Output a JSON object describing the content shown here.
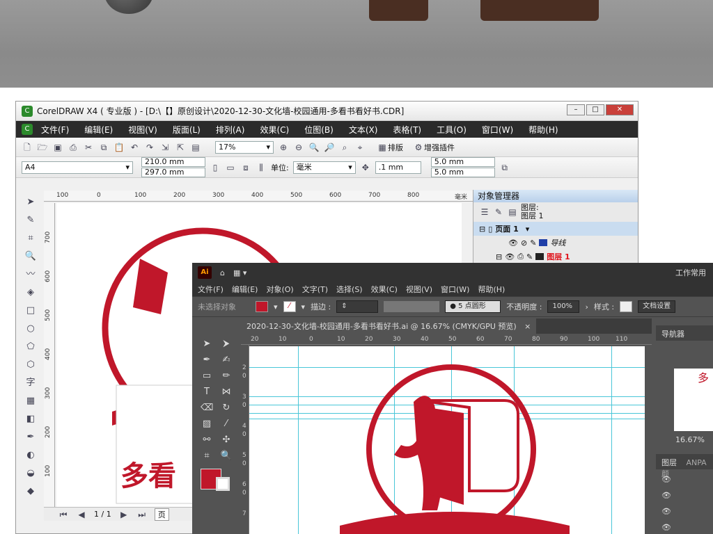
{
  "corel": {
    "title": "CorelDRAW X4 ( 专业版 ) - [D:\\【】原创设计\\2020-12-30-文化墙-校园通用-多看书看好书.CDR]",
    "menu": [
      "文件(F)",
      "编辑(E)",
      "视图(V)",
      "版面(L)",
      "排列(A)",
      "效果(C)",
      "位图(B)",
      "文本(X)",
      "表格(T)",
      "工具(O)",
      "窗口(W)",
      "帮助(H)"
    ],
    "zoom": "17%",
    "paper": "A4",
    "width": "210.0 mm",
    "height": "297.0 mm",
    "unit_label": "单位:",
    "unit": "毫米",
    "nudge": ".1 mm",
    "dup_x": "5.0 mm",
    "dup_y": "5.0 mm",
    "btn_arrange": "排版",
    "btn_plugin": "增强插件",
    "ruler_h": [
      "100",
      "0",
      "100",
      "200",
      "300",
      "400",
      "500",
      "600",
      "700",
      "800"
    ],
    "ruler_h_unit": "毫米",
    "ruler_v": [
      "700",
      "600",
      "500",
      "400",
      "300",
      "200",
      "100"
    ],
    "page_nav": "1 / 1",
    "page_tab": "页",
    "canvas_text": "多看",
    "objmgr": {
      "title": "对象管理器",
      "layer_label": "图层:",
      "layer_value": "图层 1",
      "page": "页面 1",
      "guides": "导线",
      "layer1": "图层 1"
    }
  },
  "ai": {
    "logo": "Ai",
    "workspace": "工作常用",
    "menu": [
      "文件(F)",
      "编辑(E)",
      "对象(O)",
      "文字(T)",
      "选择(S)",
      "效果(C)",
      "视图(V)",
      "窗口(W)",
      "帮助(H)"
    ],
    "no_selection": "未选择对象",
    "stroke_label": "描边 :",
    "brush": "5 点圆形",
    "opacity_label": "不透明度 :",
    "opacity": "100%",
    "style_label": "样式 :",
    "doc_setup": "文档设置",
    "tab_title": "2020-12-30-文化墙-校园通用-多看书看好书.ai @ 16.67% (CMYK/GPU 预览)",
    "tab_close": "×",
    "ruler_h": [
      "20",
      "10",
      "0",
      "10",
      "20",
      "30",
      "40",
      "50",
      "60",
      "70",
      "80",
      "90",
      "100",
      "110"
    ],
    "ruler_v": [
      "2",
      "0",
      "3",
      "0",
      "4",
      "0",
      "5",
      "0",
      "6",
      "0",
      "7"
    ],
    "navigator": "导航器",
    "nav_zoom": "16.67%",
    "nav_preview_char": "多",
    "layers": "图层",
    "anpa": "ANPA 颜",
    "fill_color": "#c0172a"
  },
  "colors": {
    "brand_red": "#c0172a"
  }
}
